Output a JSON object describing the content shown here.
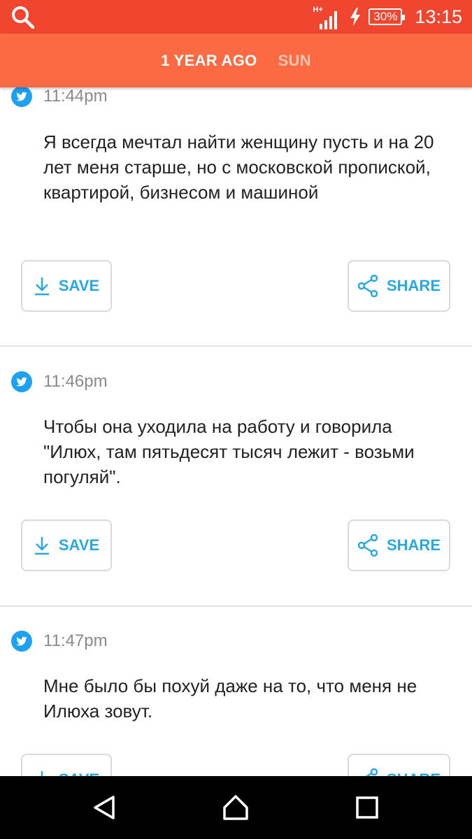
{
  "status_bar": {
    "network_label": "H+",
    "battery": "30%",
    "time": "13:15",
    "icons": [
      "search-icon",
      "signal-icon",
      "charging-icon",
      "battery-icon"
    ]
  },
  "header": {
    "tabs": [
      {
        "label": "1 YEAR AGO",
        "active": true
      },
      {
        "label": "SUN",
        "active": false
      }
    ]
  },
  "posts": [
    {
      "time": "11:44pm",
      "text": "Я всегда мечтал найти женщину пусть и на 20 лет меня старше, но с московской пропиской,  квартирой,  бизнесом и машиной"
    },
    {
      "time": "11:46pm",
      "text": "Чтобы она уходила на работу и говорила \"Илюх, там пятьдесят тысяч лежит - возьми погуляй\"."
    },
    {
      "time": "11:47pm",
      "text": "Мне было бы похуй даже на то,  что меня не Илюха зовут."
    }
  ],
  "actions": {
    "save_label": "SAVE",
    "share_label": "SHARE"
  },
  "colors": {
    "status_bar": "#f0452f",
    "header": "#fb6a42",
    "accent": "#2aa8e0",
    "twitter": "#1da1f2"
  }
}
